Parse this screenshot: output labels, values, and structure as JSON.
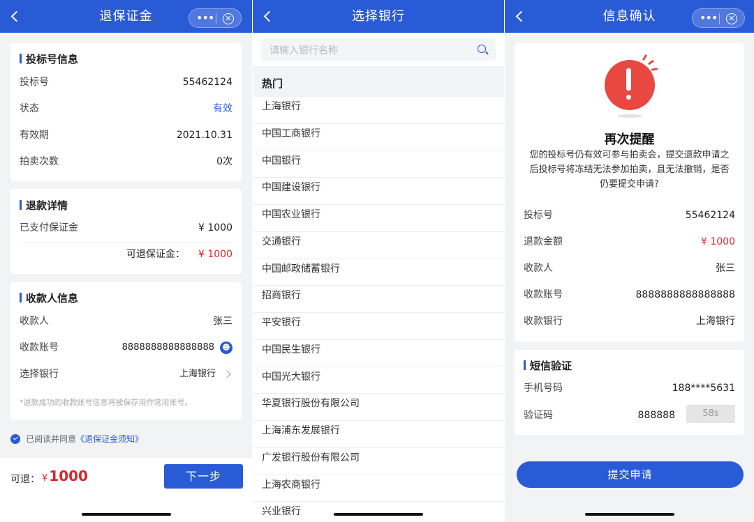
{
  "screen1": {
    "title": "退保证金",
    "bid_section": {
      "title": "投标号信息",
      "rows": [
        {
          "label": "投标号",
          "value": "55462124"
        },
        {
          "label": "状态",
          "value": "有效"
        },
        {
          "label": "有效期",
          "value": "2021.10.31"
        },
        {
          "label": "拍卖次数",
          "value": "0次"
        }
      ]
    },
    "refund_section": {
      "title": "退款详情",
      "paid_label": "已支付保证金",
      "paid_value": "¥ 1000",
      "refundable_label": "可退保证金：",
      "refundable_value": "¥ 1000"
    },
    "payee_section": {
      "title": "收款人信息",
      "payee_label": "收款人",
      "payee_value": "张三",
      "account_label": "收款账号",
      "account_value": "8888888888888888",
      "bank_label": "选择银行",
      "bank_value": "上海银行",
      "hint": "*退款成功的收款账号信息将被保存用作常用账号。"
    },
    "agree_text": "已阅读并同意",
    "agree_link": "《退保证金须知》",
    "refund_label": "可退：",
    "refund_currency": "¥",
    "refund_amount": "1000",
    "next_button": "下一步"
  },
  "screen2": {
    "title": "选择银行",
    "search_placeholder": "请输入银行名称",
    "hot_label": "热门",
    "banks": [
      "上海银行",
      "中国工商银行",
      "中国银行",
      "中国建设银行",
      "中国农业银行",
      "交通银行",
      "中国邮政储蓄银行",
      "招商银行",
      "平安银行",
      "中国民生银行",
      "中国光大银行",
      "华夏银行股份有限公司",
      "上海浦东发展银行",
      "广发银行股份有限公司",
      "上海农商银行",
      "兴业银行"
    ]
  },
  "screen3": {
    "title": "信息确认",
    "remind_title": "再次提醒",
    "remind_text": "您的投标号仍有效可参与拍卖会，提交退款申请之后投标号将冻结无法参加拍卖，且无法撤销，是否仍要提交申请?",
    "rows": [
      {
        "label": "投标号",
        "value": "55462124"
      },
      {
        "label": "退款金额",
        "value": "¥ 1000"
      },
      {
        "label": "收款人",
        "value": "张三"
      },
      {
        "label": "收款账号",
        "value": "8888888888888888"
      },
      {
        "label": "收款银行",
        "value": "上海银行"
      }
    ],
    "sms_title": "短信验证",
    "phone_label": "手机号码",
    "phone_value": "188****5631",
    "code_label": "验证码",
    "code_value": "888888",
    "countdown": "58s",
    "submit_button": "提交申请"
  },
  "capsule": {
    "more": "•••",
    "close": "✕"
  },
  "colors": {
    "primary": "#2a5bd7",
    "accent_red": "#d8262a",
    "warning": "#e94841"
  }
}
